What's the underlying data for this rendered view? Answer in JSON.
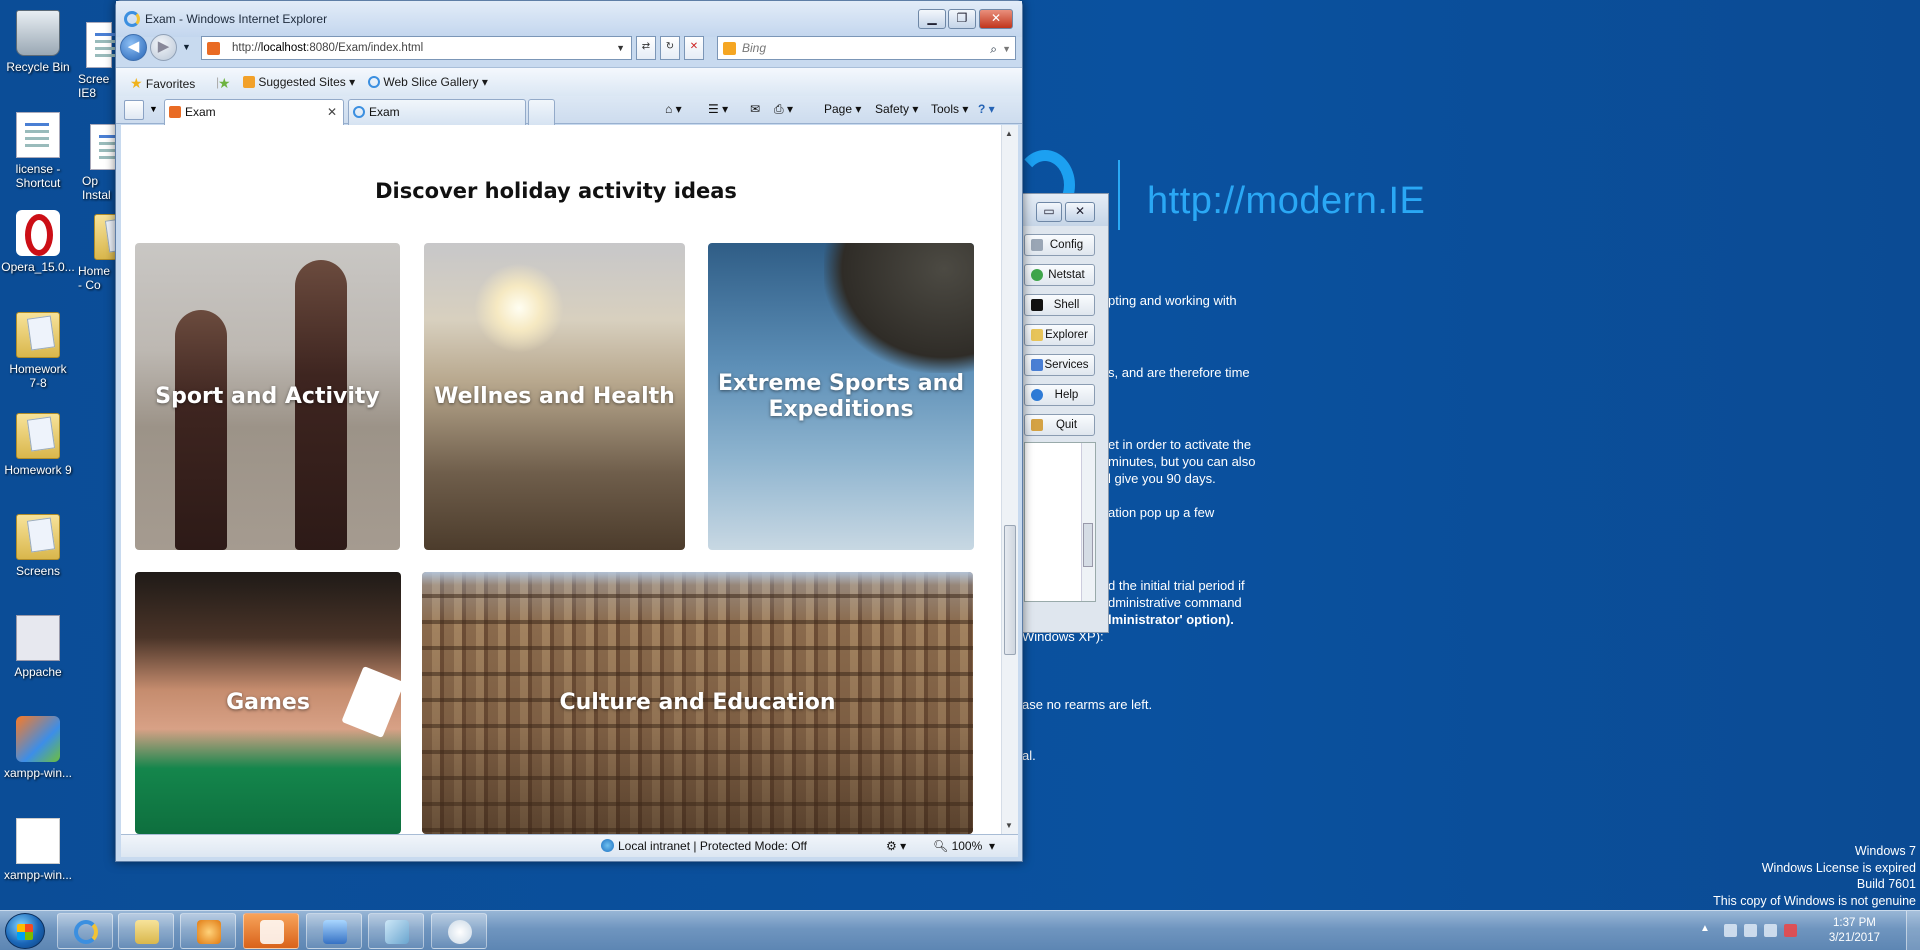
{
  "desktop": {
    "icons": [
      {
        "label": "Recycle Bin",
        "kind": "bin"
      },
      {
        "label": "license - Shortcut",
        "kind": "doc"
      },
      {
        "label": "Opera_15.0...",
        "kind": "opera"
      },
      {
        "label": "Homework 7-8",
        "kind": "folder"
      },
      {
        "label": "Homework 9",
        "kind": "folder"
      },
      {
        "label": "Screens",
        "kind": "folder"
      },
      {
        "label": "Appache",
        "kind": "apache"
      },
      {
        "label": "xampp-win...",
        "kind": "xampp"
      },
      {
        "label": "xampp-win...",
        "kind": "blank"
      }
    ],
    "partial_icons": [
      {
        "label": "Scree IE8"
      },
      {
        "label": "Op Instal"
      },
      {
        "label": "Home - Co"
      }
    ],
    "modern_ie_text": "http://modern.IE",
    "background_lines": [
      "pting and working with",
      "s, and are therefore time",
      "et in order to activate the",
      "minutes, but you can also",
      "l give you 90 days.",
      "ation pop up a few",
      "d the initial trial period if",
      "dministrative command",
      "lministrator' option).",
      "Windows XP):",
      "ase no rearms are left.",
      "al."
    ],
    "watermark": [
      "Windows 7",
      "Windows License is expired",
      "Build 7601",
      "This copy of Windows is not genuine"
    ]
  },
  "ie": {
    "window_title": "Exam - Windows Internet Explorer",
    "address_prefix": "http://",
    "address_host": "localhost",
    "address_rest": ":8080/Exam/index.html",
    "search_placeholder": "Bing",
    "favorites_label": "Favorites",
    "suggested_sites": "Suggested Sites",
    "web_slice_gallery": "Web Slice Gallery",
    "tabs": [
      {
        "label": "Exam",
        "active": true
      },
      {
        "label": "Exam",
        "active": false
      }
    ],
    "commands": {
      "page": "Page",
      "safety": "Safety",
      "tools": "Tools"
    },
    "status": {
      "zone": "Local intranet | Protected Mode: Off",
      "zoom": "100%"
    }
  },
  "page": {
    "heading": "Discover holiday activity ideas",
    "tiles": [
      {
        "label": "Sport and Activity"
      },
      {
        "label": "Wellnes and Health"
      },
      {
        "label": "Extreme Sports and Expeditions"
      },
      {
        "label": "Games"
      },
      {
        "label": "Culture and Education"
      }
    ]
  },
  "tool_window": {
    "buttons": [
      "Config",
      "Netstat",
      "Shell",
      "Explorer",
      "Services",
      "Help",
      "Quit"
    ]
  },
  "taskbar": {
    "time": "1:37 PM",
    "date": "3/21/2017"
  },
  "colors": {
    "desktop_bg": "#0a4f9b",
    "modern_ie_accent": "#2aa8f5",
    "ie_frame": "#c8daef",
    "close_button": "#c1351c"
  }
}
